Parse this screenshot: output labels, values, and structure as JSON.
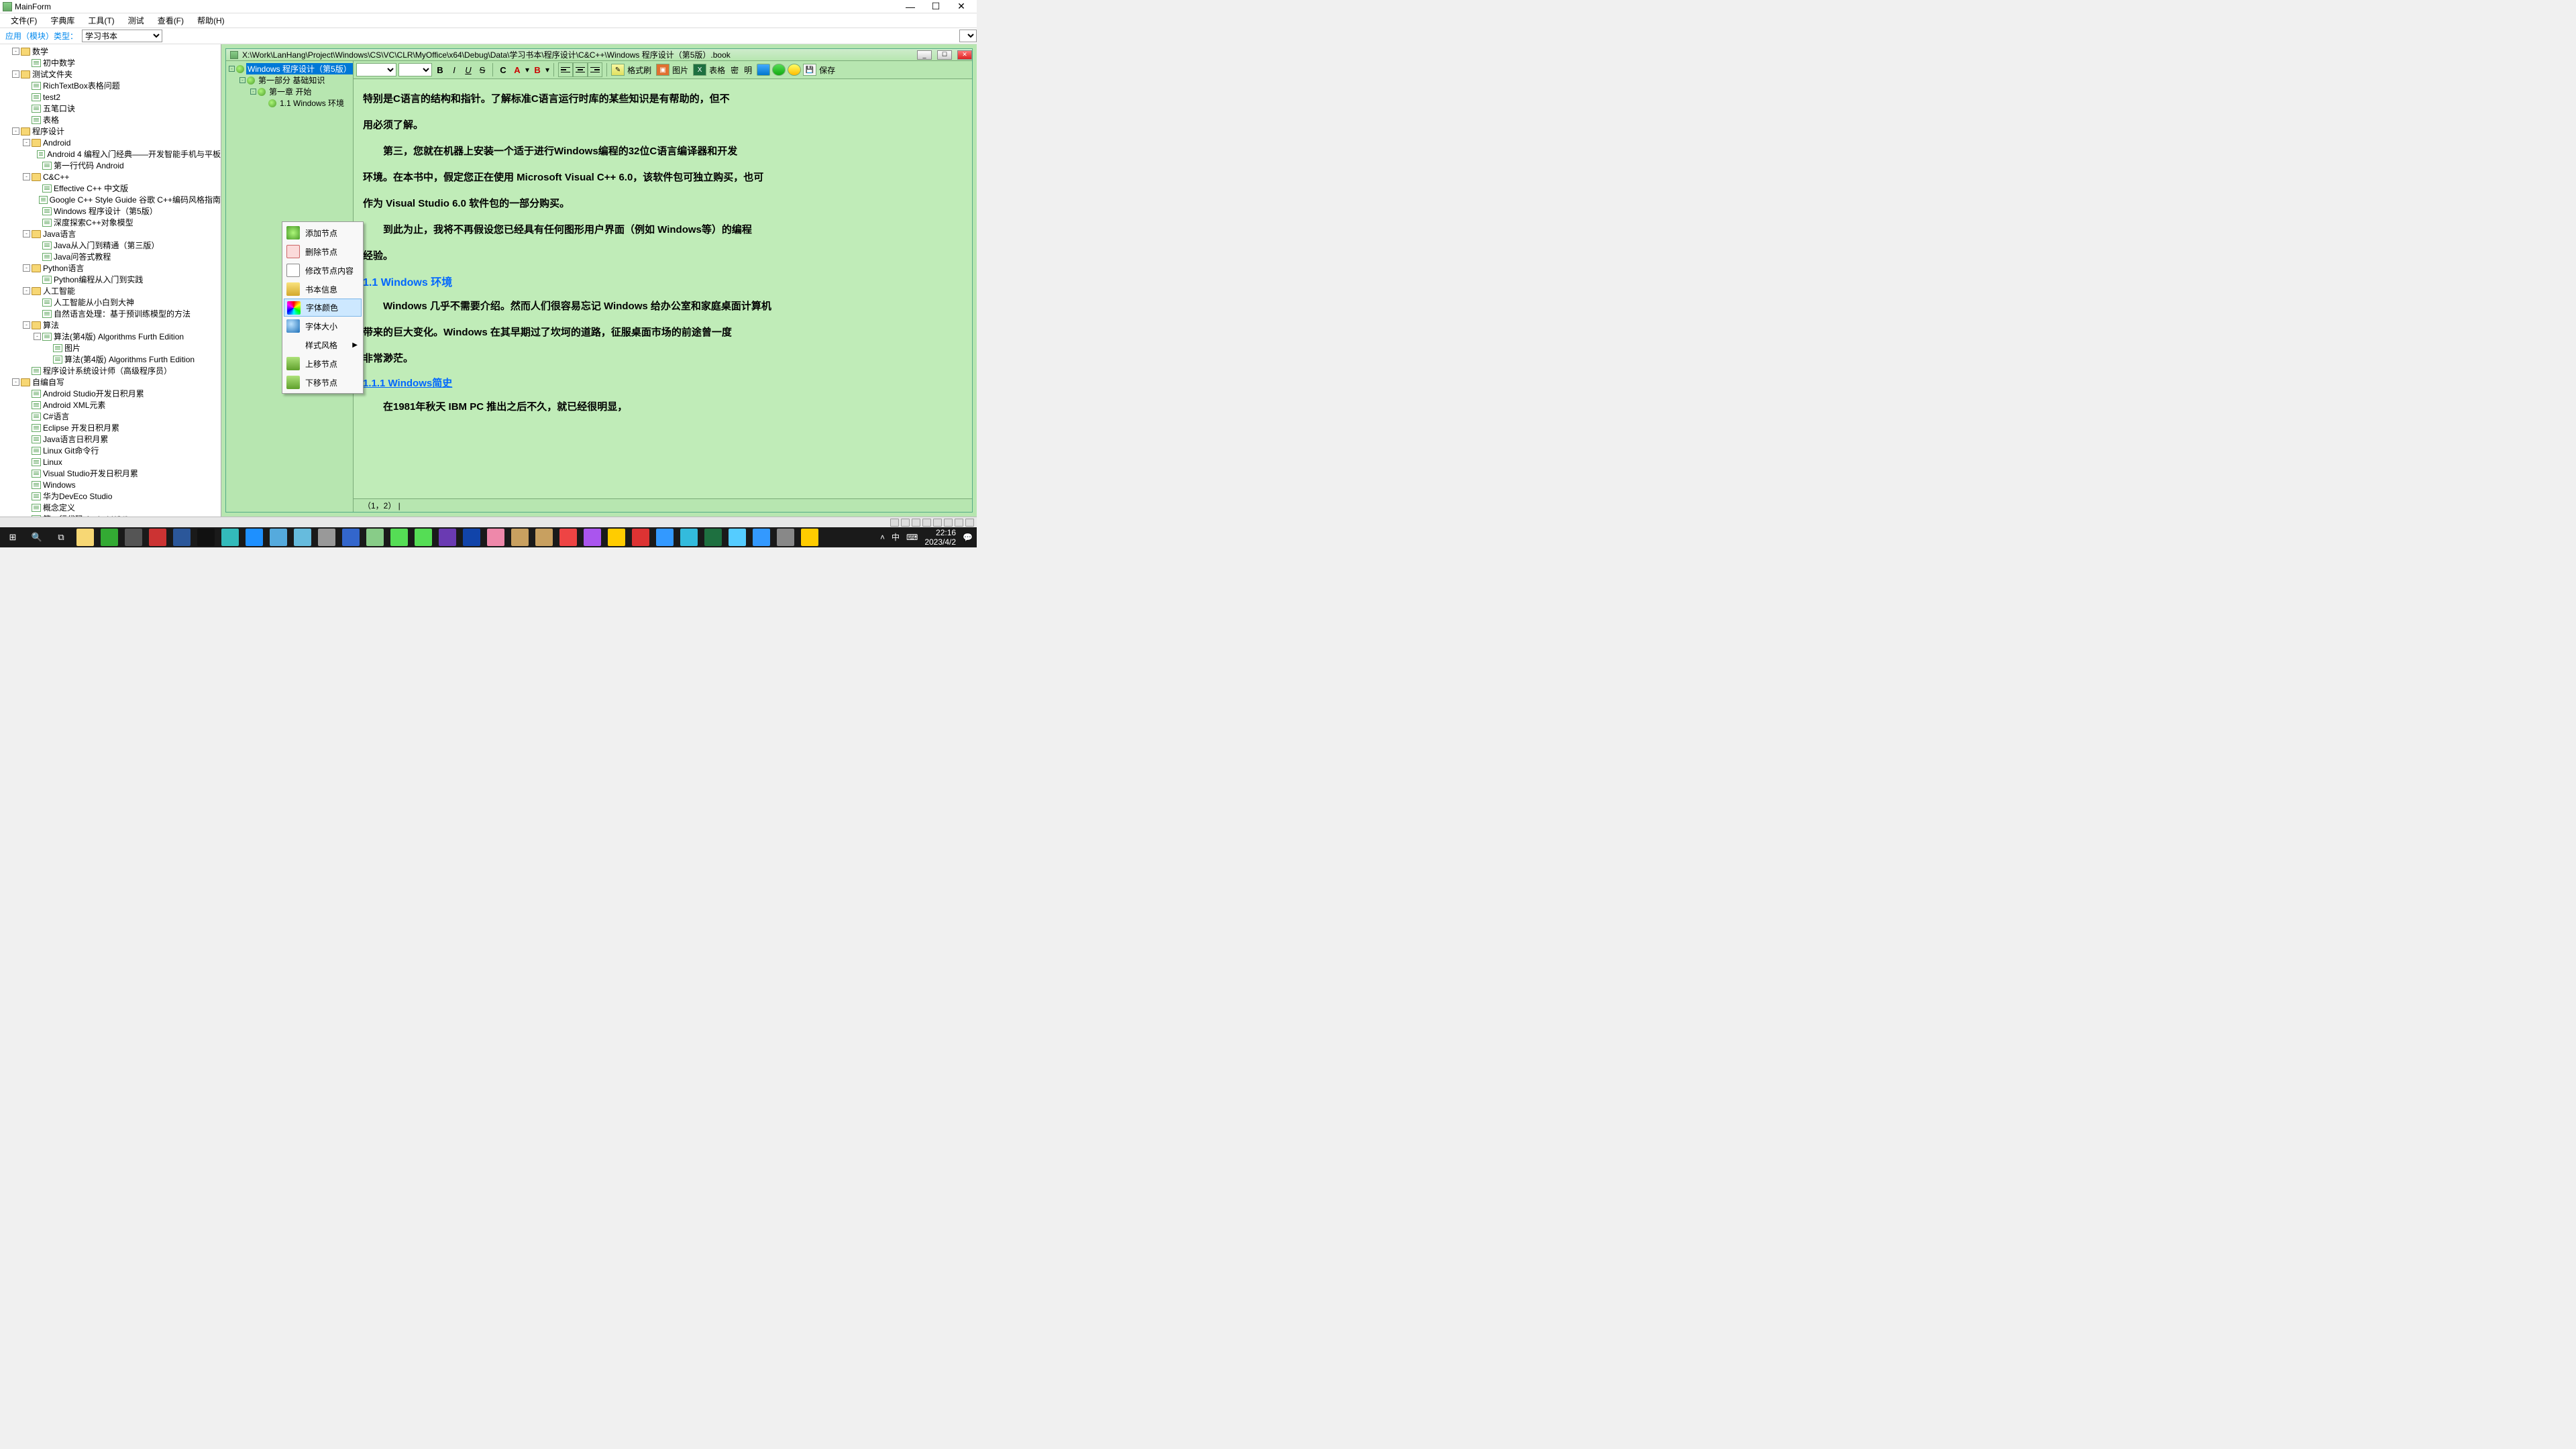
{
  "window": {
    "title": "MainForm"
  },
  "menubar": [
    "文件(F)",
    "字典库",
    "工具(T)",
    "测试",
    "查看(F)",
    "帮助(H)"
  ],
  "module": {
    "label": "应用（模块）类型：",
    "selected": "学习书本"
  },
  "tree": [
    {
      "d": 0,
      "t": "-",
      "i": "fld",
      "l": "数学"
    },
    {
      "d": 1,
      "t": "",
      "i": "doc",
      "l": "初中数学"
    },
    {
      "d": 0,
      "t": "-",
      "i": "fld",
      "l": "测试文件夹"
    },
    {
      "d": 1,
      "t": "",
      "i": "doc",
      "l": "RichTextBox表格问题"
    },
    {
      "d": 1,
      "t": "",
      "i": "doc",
      "l": "test2"
    },
    {
      "d": 1,
      "t": "",
      "i": "doc",
      "l": "五笔口诀"
    },
    {
      "d": 1,
      "t": "",
      "i": "doc",
      "l": "表格"
    },
    {
      "d": 0,
      "t": "-",
      "i": "fld",
      "l": "程序设计"
    },
    {
      "d": 1,
      "t": "-",
      "i": "fld",
      "l": "Android"
    },
    {
      "d": 2,
      "t": "",
      "i": "doc",
      "l": "Android 4 编程入门经典——开发智能手机与平板"
    },
    {
      "d": 2,
      "t": "",
      "i": "doc",
      "l": "第一行代码 Android"
    },
    {
      "d": 1,
      "t": "-",
      "i": "fld",
      "l": "C&C++"
    },
    {
      "d": 2,
      "t": "",
      "i": "doc",
      "l": "Effective C++ 中文版"
    },
    {
      "d": 2,
      "t": "",
      "i": "doc",
      "l": "Google C++ Style Guide 谷歌 C++编码风格指南"
    },
    {
      "d": 2,
      "t": "",
      "i": "doc",
      "l": "Windows  程序设计（第5版）"
    },
    {
      "d": 2,
      "t": "",
      "i": "doc",
      "l": "深度探索C++对象模型"
    },
    {
      "d": 1,
      "t": "-",
      "i": "fld",
      "l": "Java语言"
    },
    {
      "d": 2,
      "t": "",
      "i": "doc",
      "l": "Java从入门到精通（第三版）"
    },
    {
      "d": 2,
      "t": "",
      "i": "doc",
      "l": "Java问答式教程"
    },
    {
      "d": 1,
      "t": "-",
      "i": "fld",
      "l": "Python语言"
    },
    {
      "d": 2,
      "t": "",
      "i": "doc",
      "l": "Python编程从入门到实践"
    },
    {
      "d": 1,
      "t": "-",
      "i": "fld",
      "l": "人工智能"
    },
    {
      "d": 2,
      "t": "",
      "i": "doc",
      "l": "人工智能从小白到大神"
    },
    {
      "d": 2,
      "t": "",
      "i": "doc",
      "l": "自然语言处理：基于预训练模型的方法"
    },
    {
      "d": 1,
      "t": "-",
      "i": "fld",
      "l": "算法"
    },
    {
      "d": 2,
      "t": "-",
      "i": "doc",
      "l": "算法(第4版) Algorithms Furth Edition"
    },
    {
      "d": 3,
      "t": "",
      "i": "doc",
      "l": "图片"
    },
    {
      "d": 3,
      "t": "",
      "i": "doc",
      "l": "算法(第4版) Algorithms Furth Edition"
    },
    {
      "d": 1,
      "t": "",
      "i": "doc",
      "l": "程序设计系统设计师（高级程序员）"
    },
    {
      "d": 0,
      "t": "-",
      "i": "fld",
      "l": "自编自写"
    },
    {
      "d": 1,
      "t": "",
      "i": "doc",
      "l": "Android Studio开发日积月累"
    },
    {
      "d": 1,
      "t": "",
      "i": "doc",
      "l": "Android XML元素"
    },
    {
      "d": 1,
      "t": "",
      "i": "doc",
      "l": "C#语言"
    },
    {
      "d": 1,
      "t": "",
      "i": "doc",
      "l": "Eclipse 开发日积月累"
    },
    {
      "d": 1,
      "t": "",
      "i": "doc",
      "l": "Java语言日积月累"
    },
    {
      "d": 1,
      "t": "",
      "i": "doc",
      "l": "Linux Git命令行"
    },
    {
      "d": 1,
      "t": "",
      "i": "doc",
      "l": "Linux"
    },
    {
      "d": 1,
      "t": "",
      "i": "doc",
      "l": "Visual Studio开发日积月累"
    },
    {
      "d": 1,
      "t": "",
      "i": "doc",
      "l": "Windows"
    },
    {
      "d": 1,
      "t": "",
      "i": "doc",
      "l": "华为DevEco Studio"
    },
    {
      "d": 1,
      "t": "",
      "i": "doc",
      "l": "概念定义"
    },
    {
      "d": 1,
      "t": "",
      "i": "doc",
      "l": "第一行代码 Android(C#)"
    }
  ],
  "book": {
    "path": "X:\\Work\\LanHang\\Project\\Windows\\CS\\VC\\CLR\\MyOffice\\x64\\Debug\\Data\\学习书本\\程序设计\\C&C++\\Windows  程序设计（第5版）.book",
    "nav": [
      {
        "d": 0,
        "t": "-",
        "i": "leaf",
        "l": "Windows  程序设计（第5版）",
        "sel": true
      },
      {
        "d": 1,
        "t": "-",
        "i": "leaf",
        "l": "第一部分 基础知识"
      },
      {
        "d": 2,
        "t": "-",
        "i": "leaf",
        "l": "第一章 开始"
      },
      {
        "d": 3,
        "t": "",
        "i": "leaf",
        "l": "1.1 Windows 环境"
      }
    ],
    "toolbar": {
      "bold": "B",
      "italic": "I",
      "underline": "U",
      "strike": "S",
      "fontcolor": "C",
      "bgcolor": "A",
      "hlcolor": "B",
      "brush": "格式刷",
      "pic": "图片",
      "table": "表格",
      "pwd": "密",
      "plain": "明",
      "save": "保存"
    },
    "content": {
      "p1": "特别是C语言的结构和指针。了解标准C语言运行时库的某些知识是有帮助的，但不",
      "p2": "用必须了解。",
      "p3": "第三，您就在机器上安装一个适于进行Windows编程的32位C语言编译器和开发",
      "p4": "环境。在本书中，假定您正在使用 Microsoft Visual C++ 6.0，该软件包可独立购买，也可",
      "p5": "作为 Visual Studio 6.0 软件包的一部分购买。",
      "p6": "到此为止，我将不再假设您已经具有任何图形用户界面（例如 Windows等）的编程",
      "p7": "经验。",
      "h1": "1.1 Windows 环境",
      "p8": "Windows 几乎不需要介绍。然而人们很容易忘记 Windows 给办公室和家庭桌面计算机",
      "p9": "带来的巨大变化。Windows 在其早期过了坎坷的道路，征服桌面市场的前途曾一度",
      "p10": "非常渺茫。",
      "h2": "1.1.1 Windows简史",
      "p11": "在1981年秋天 IBM PC 推出之后不久，就已经很明显，"
    },
    "status": "（1，2）  |"
  },
  "context_menu": [
    {
      "ico": "add",
      "l": "添加节点"
    },
    {
      "ico": "del",
      "l": "删除节点"
    },
    {
      "ico": "edit",
      "l": "修改节点内容"
    },
    {
      "ico": "info",
      "l": "书本信息"
    },
    {
      "ico": "color",
      "l": "字体颜色",
      "sel": true
    },
    {
      "ico": "size",
      "l": "字体大小"
    },
    {
      "ico": "",
      "l": "样式风格",
      "sub": true
    },
    {
      "ico": "up",
      "l": "上移节点"
    },
    {
      "ico": "dn",
      "l": "下移节点"
    }
  ],
  "clock": {
    "time": "22:16",
    "date": "2023/4/2"
  }
}
